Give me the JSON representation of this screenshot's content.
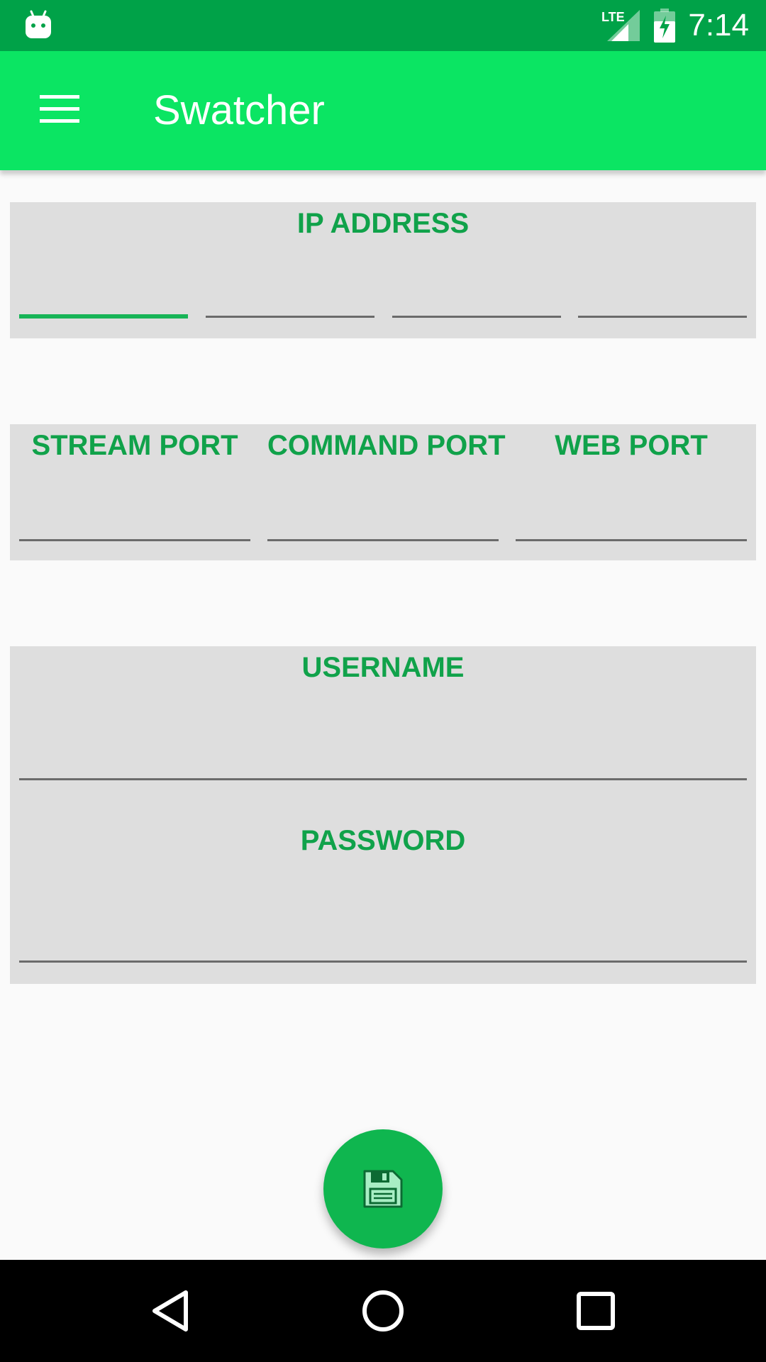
{
  "status_bar": {
    "time": "7:14",
    "network": "LTE",
    "icons": [
      "android-debug-icon",
      "lte-signal-icon",
      "battery-charging-icon"
    ]
  },
  "app_bar": {
    "title": "Swatcher",
    "menu_icon": "hamburger-menu-icon",
    "background": "#0be563"
  },
  "ip_section": {
    "label": "IP ADDRESS",
    "octets": [
      "",
      "",
      "",
      ""
    ]
  },
  "ports_section": {
    "stream_label": "STREAM PORT",
    "command_label": "COMMAND PORT",
    "web_label": "WEB PORT",
    "stream_value": "",
    "command_value": "",
    "web_value": ""
  },
  "credentials_section": {
    "username_label": "USERNAME",
    "password_label": "PASSWORD",
    "username_value": "",
    "password_value": ""
  },
  "fab": {
    "icon": "save-floppy-icon",
    "color": "#0fb64f"
  },
  "nav_bar": {
    "icons": [
      "back-icon",
      "home-icon",
      "recents-icon"
    ]
  },
  "colors": {
    "status_bar": "#00a248",
    "label_green": "#10a24a",
    "panel_gray": "#dedede",
    "focus_underline": "#17b457"
  }
}
